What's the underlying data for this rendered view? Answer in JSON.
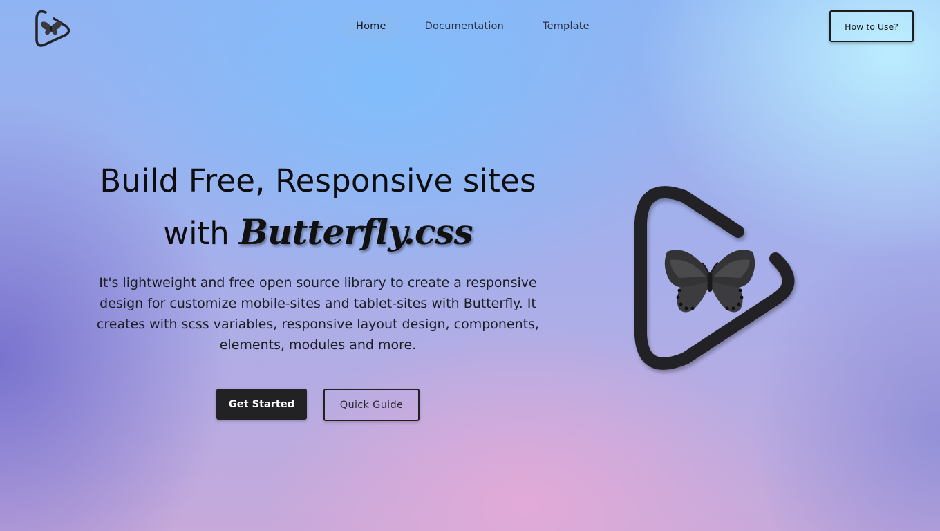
{
  "nav": {
    "items": [
      {
        "label": "Home",
        "active": true
      },
      {
        "label": "Documentation",
        "active": false
      },
      {
        "label": "Template",
        "active": false
      }
    ],
    "how_to_label": "How to Use?"
  },
  "hero": {
    "title_line1": "Build Free, Responsive sites",
    "title_with": "with",
    "title_brand": "Butterfly.css",
    "description": "It's lightweight and free open source library to create a responsive design for customize mobile-sites and tablet-sites with Butterfly. It creates with scss variables, responsive layout design, components, elements, modules and more.",
    "primary_button": "Get Started",
    "secondary_button": "Quick Guide"
  },
  "icons": {
    "logo": "butterfly-play-logo-icon",
    "hero_logo": "butterfly-play-logo-icon"
  },
  "colors": {
    "dark": "#222224",
    "nav_active_bg": "#8cb9f0"
  }
}
